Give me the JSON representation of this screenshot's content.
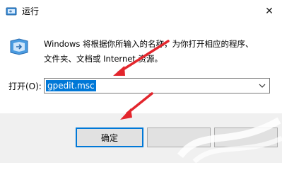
{
  "window": {
    "title": "运行",
    "close_icon": "close-icon",
    "app_icon": "run-app-icon"
  },
  "dialog": {
    "icon": "run-dialog-icon",
    "description": "Windows 将根据你所输入的名称，为你打开相应的程序、\n文件夹、文档或 Internet 资源。",
    "open_label": "打开(O):",
    "open_value": "gpedit.msc",
    "dropdown_icon": "chevron-down-icon"
  },
  "buttons": {
    "ok_label": "确定",
    "cancel_label": "",
    "browse_label": ""
  },
  "colors": {
    "accent": "#0078d7",
    "arrow": "#e3262d",
    "footer_bg": "#f0f0f0"
  }
}
